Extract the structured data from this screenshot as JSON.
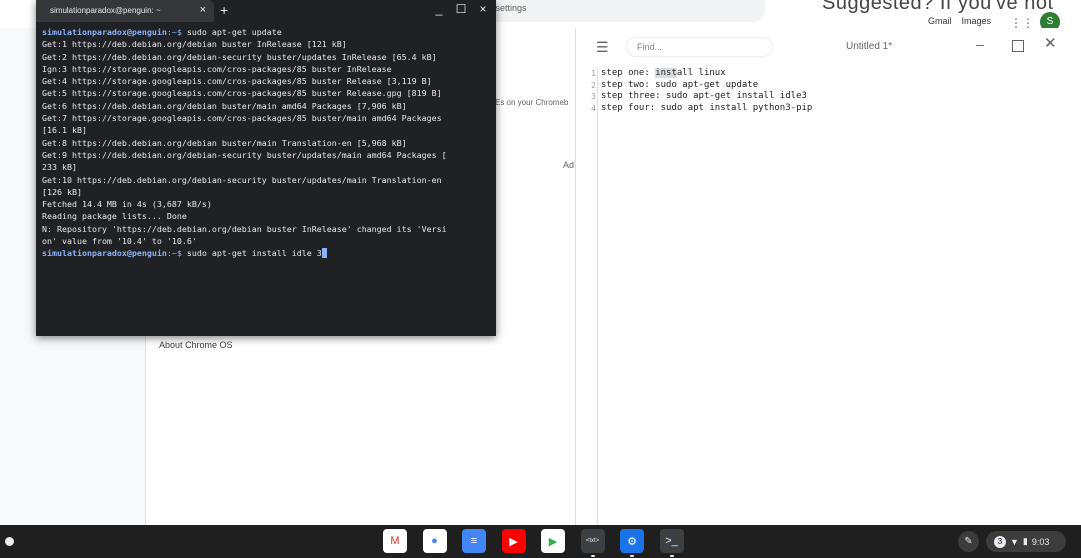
{
  "background": {
    "omnibox_text": "n settings",
    "watermark": "Suggested? If you've not",
    "links": [
      "Gmail",
      "Images"
    ],
    "avatar_letter": "S",
    "row_text": "Es on your Chromeb",
    "ad_text": "Ad",
    "about": "About Chrome OS"
  },
  "terminal": {
    "tab_title": "simulationparadox@penguin: ~",
    "lines": [
      {
        "prompt": "simulationparadox@penguin",
        "path": ":~$ ",
        "cmd": "sudo apt-get update"
      },
      {
        "text": "Get:1 https://deb.debian.org/debian buster InRelease [121 kB]"
      },
      {
        "text": "Get:2 https://deb.debian.org/debian-security buster/updates InRelease [65.4 kB]"
      },
      {
        "text": "Ign:3 https://storage.googleapis.com/cros-packages/85 buster InRelease"
      },
      {
        "text": "Get:4 https://storage.googleapis.com/cros-packages/85 buster Release [3,119 B]"
      },
      {
        "text": "Get:5 https://storage.googleapis.com/cros-packages/85 buster Release.gpg [819 B]"
      },
      {
        "text": "Get:6 https://deb.debian.org/debian buster/main amd64 Packages [7,906 kB]"
      },
      {
        "text": "Get:7 https://storage.googleapis.com/cros-packages/85 buster/main amd64 Packages"
      },
      {
        "text": "[16.1 kB]"
      },
      {
        "text": "Get:8 https://deb.debian.org/debian buster/main Translation-en [5,968 kB]"
      },
      {
        "text": "Get:9 https://deb.debian.org/debian-security buster/updates/main amd64 Packages ["
      },
      {
        "text": "233 kB]"
      },
      {
        "text": "Get:10 https://deb.debian.org/debian-security buster/updates/main Translation-en"
      },
      {
        "text": "[126 kB]"
      },
      {
        "text": "Fetched 14.4 MB in 4s (3,687 kB/s)"
      },
      {
        "text": "Reading package lists... Done"
      },
      {
        "text": "N: Repository 'https://deb.debian.org/debian buster InRelease' changed its 'Versi"
      },
      {
        "text": "on' value from '10.4' to '10.6'"
      },
      {
        "prompt": "simulationparadox@penguin",
        "path": ":~$ ",
        "cmd": "sudo apt-get install idle 3",
        "cursor": true
      }
    ]
  },
  "editor": {
    "find_placeholder": "Find...",
    "title": "Untitled 1*",
    "lines": [
      {
        "n": "1",
        "pre": "step one: ",
        "hl": "inst",
        "post": "all linux"
      },
      {
        "n": "2",
        "pre": "step two: sudo apt-get update",
        "hl": "",
        "post": ""
      },
      {
        "n": "3",
        "pre": "step three: sudo apt-get install idle3",
        "hl": "",
        "post": ""
      },
      {
        "n": "4",
        "pre": "step four: sudo apt install python3-pip",
        "hl": "",
        "post": ""
      }
    ]
  },
  "shelf": {
    "apps": [
      {
        "name": "gmail-icon",
        "glyph": "M",
        "bg": "#ffffff",
        "fg": "#d93025"
      },
      {
        "name": "chrome-icon",
        "glyph": "●",
        "bg": "#ffffff",
        "fg": "#4285f4"
      },
      {
        "name": "docs-icon",
        "glyph": "≡",
        "bg": "#4285f4",
        "fg": "#ffffff"
      },
      {
        "name": "youtube-icon",
        "glyph": "▶",
        "bg": "#ff0000",
        "fg": "#ffffff"
      },
      {
        "name": "play-store-icon",
        "glyph": "▶",
        "bg": "#ffffff",
        "fg": "#34a853"
      },
      {
        "name": "text-app-icon",
        "glyph": "<txt>",
        "bg": "#3c4043",
        "fg": "#e8eaed"
      },
      {
        "name": "settings-icon",
        "glyph": "⚙",
        "bg": "#1a73e8",
        "fg": "#ffffff"
      },
      {
        "name": "terminal-icon",
        "glyph": ">_",
        "bg": "#3c4043",
        "fg": "#e8eaed"
      }
    ],
    "notif_count": "3",
    "time": "9:03"
  }
}
